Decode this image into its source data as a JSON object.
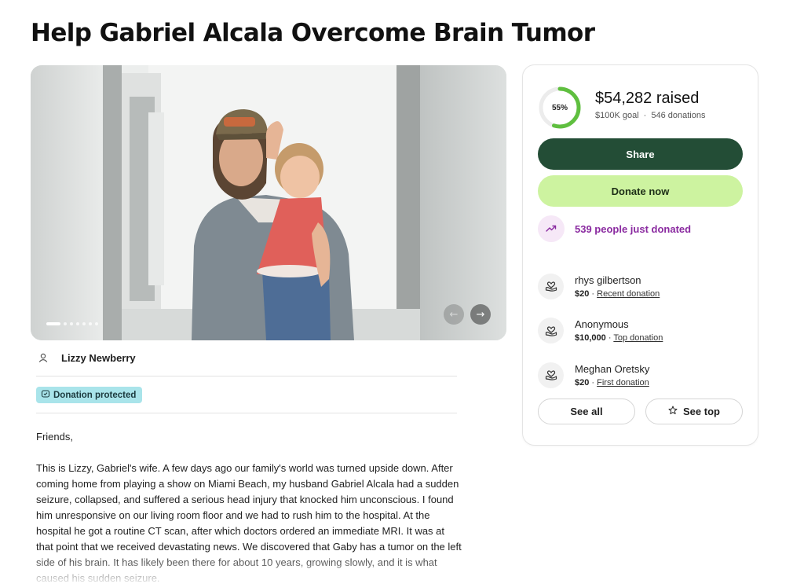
{
  "page_title": "Help Gabriel Alcala Overcome Brain Tumor",
  "gallery": {
    "image_alt": "Gabriel holding his daughter",
    "slide_index": 1,
    "slide_count": 8
  },
  "organizer": {
    "name": "Lizzy Newberry"
  },
  "badge": {
    "label": "Donation protected"
  },
  "story": {
    "greeting": "Friends,",
    "body": "This is Lizzy, Gabriel's wife. A few days ago our family's world was turned upside down. After coming home from playing a show on Miami Beach, my husband Gabriel Alcala had a sudden seizure, collapsed, and suffered a serious head injury that knocked him unconscious. I found him unresponsive on our living room floor and we had to rush him to the hospital. At the hospital he got a routine CT scan, after which doctors ordered an immediate MRI. It was at that point that we received devastating news. We discovered that Gaby has a tumor on the left side of his brain. It has likely been there for about 10 years, growing slowly, and it is what caused his sudden seizure."
  },
  "fundraiser": {
    "progress_label": "55%",
    "progress_fraction": 0.55,
    "raised": "$54,282 raised",
    "goal": "$100K goal",
    "separator": "·",
    "donations": "546 donations",
    "share_label": "Share",
    "donate_label": "Donate now",
    "trending": "539 people just donated",
    "donors": [
      {
        "name": "rhys gilbertson",
        "amount": "$20",
        "sep": " · ",
        "tag": "Recent donation"
      },
      {
        "name": "Anonymous",
        "amount": "$10,000",
        "sep": " · ",
        "tag": "Top donation"
      },
      {
        "name": "Meghan Oretsky",
        "amount": "$20",
        "sep": " · ",
        "tag": "First donation"
      }
    ],
    "see_all_label": "See all",
    "see_top_label": "See top"
  },
  "colors": {
    "share_bg": "#234d36",
    "donate_bg": "#cdf3a0",
    "progress": "#5fbf3f",
    "trending": "#8a2aa0",
    "badge_bg": "#a9e4ea"
  }
}
